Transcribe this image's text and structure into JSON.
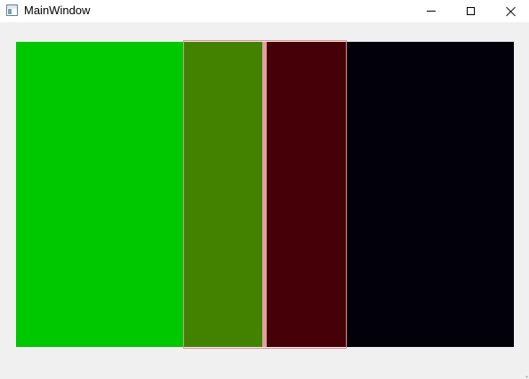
{
  "window": {
    "title": "MainWindow",
    "icon": "window-icon",
    "controls": {
      "minimize": "minimize-icon",
      "maximize": "maximize-icon",
      "close": "close-icon"
    }
  },
  "colors": {
    "background": "#f0f0f0",
    "titlebar": "#ffffff",
    "green": "#00c800",
    "olive": "#428200",
    "separator": "#e0a0a0",
    "maroon": "#460008",
    "black": "#02000a",
    "overlay_border": "#e09090"
  }
}
